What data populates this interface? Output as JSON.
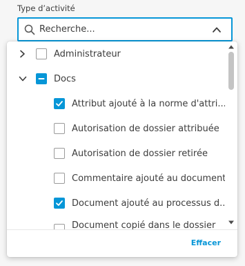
{
  "filter": {
    "label": "Type d’activité",
    "search_placeholder": "Recherche..."
  },
  "tree": [
    {
      "label": "Administrateur",
      "level": 0,
      "expanded": false,
      "state": "unchecked"
    },
    {
      "label": "Docs",
      "level": 0,
      "expanded": true,
      "state": "partial"
    },
    {
      "label": "Attribut ajouté à la norme d'attri...",
      "level": 1,
      "state": "checked"
    },
    {
      "label": "Autorisation de dossier attribuée",
      "level": 1,
      "state": "unchecked"
    },
    {
      "label": "Autorisation de dossier retirée",
      "level": 1,
      "state": "unchecked"
    },
    {
      "label": "Commentaire ajouté au document",
      "level": 1,
      "state": "unchecked"
    },
    {
      "label": "Document ajouté au processus d...",
      "level": 1,
      "state": "checked"
    },
    {
      "label": "Document copié dans le dossier",
      "level": 1,
      "state": "unchecked"
    }
  ],
  "footer": {
    "clear_label": "Effacer"
  },
  "colors": {
    "accent": "#0696d7",
    "text": "#3c3c3c",
    "checkbox_border": "#9a9a9a"
  }
}
